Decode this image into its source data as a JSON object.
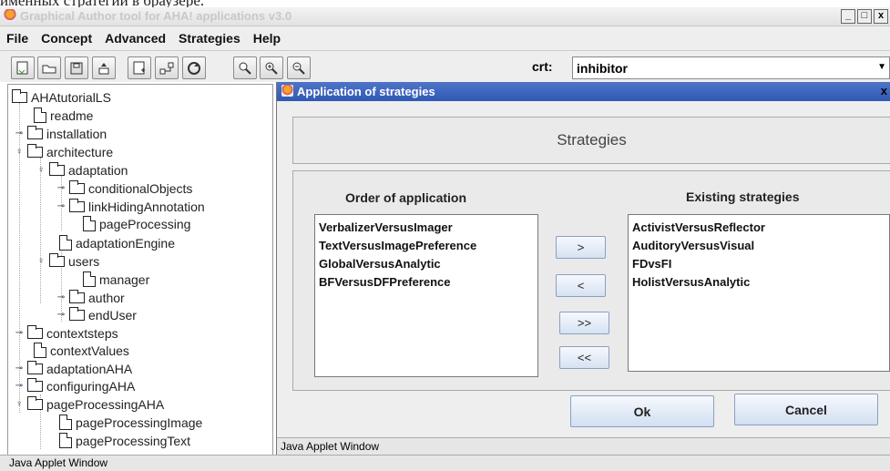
{
  "caption": "именных стратегий в браузере.",
  "window": {
    "title": "Graphical Author tool for AHA! applications v3.0",
    "buttons": [
      "_",
      "□",
      "x"
    ]
  },
  "menu": [
    "File",
    "Concept",
    "Advanced",
    "Strategies",
    "Help"
  ],
  "toolbar": {
    "buttons": [
      "new-concept-icon",
      "open-icon",
      "save-icon",
      "export-icon",
      "add-concept-icon",
      "link-icon",
      "refresh-icon",
      "search-icon",
      "zoom-in-icon",
      "zoom-out-icon"
    ],
    "crt_label": "crt:",
    "crt_value": "inhibitor"
  },
  "tree": {
    "root": "AHAtutorialLS",
    "items": [
      {
        "label": "readme",
        "type": "doc"
      },
      {
        "label": "installation",
        "type": "folder"
      },
      {
        "label": "architecture",
        "type": "folder"
      },
      {
        "label": "adaptation",
        "type": "folder"
      },
      {
        "label": "conditionalObjects",
        "type": "folder"
      },
      {
        "label": "linkHidingAnnotation",
        "type": "folder"
      },
      {
        "label": "pageProcessing",
        "type": "doc"
      },
      {
        "label": "adaptationEngine",
        "type": "doc"
      },
      {
        "label": "users",
        "type": "folder"
      },
      {
        "label": "manager",
        "type": "doc"
      },
      {
        "label": "author",
        "type": "folder"
      },
      {
        "label": "endUser",
        "type": "folder"
      },
      {
        "label": "contextsteps",
        "type": "folder"
      },
      {
        "label": "contextValues",
        "type": "doc"
      },
      {
        "label": "adaptationAHA",
        "type": "folder"
      },
      {
        "label": "configuringAHA",
        "type": "folder"
      },
      {
        "label": "pageProcessingAHA",
        "type": "folder"
      },
      {
        "label": "pageProcessingImage",
        "type": "doc"
      },
      {
        "label": "pageProcessingText",
        "type": "doc"
      }
    ]
  },
  "dialog": {
    "title": "Application of strategies",
    "close": "x",
    "panel_title": "Strategies",
    "order_header": "Order of application",
    "existing_header": "Existing strategies",
    "order_list": [
      "VerbalizerVersusImager",
      "TextVersusImagePreference",
      "GlobalVersusAnalytic",
      "BFVersusDFPreference"
    ],
    "existing_list": [
      "ActivistVersusReflector",
      "AuditoryVersusVisual",
      "FDvsFI",
      "HolistVersusAnalytic"
    ],
    "move_buttons": [
      ">",
      "<",
      ">>",
      "<<"
    ],
    "ok": "Ok",
    "cancel": "Cancel",
    "applet_status": "Java Applet Window"
  },
  "applet_status": "Java Applet Window"
}
